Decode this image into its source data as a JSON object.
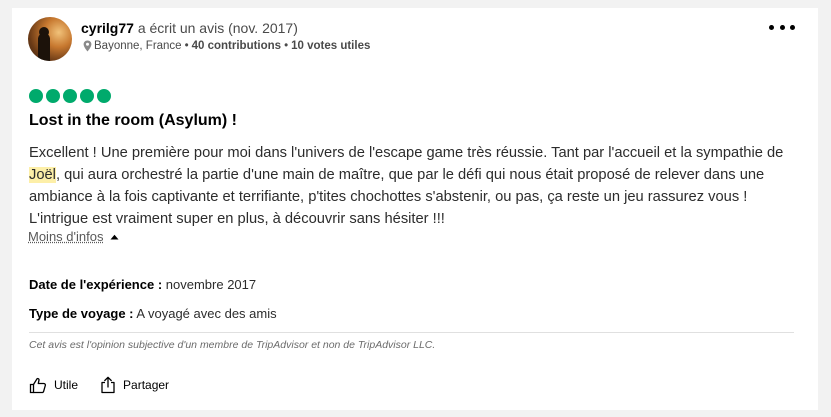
{
  "review": {
    "username": "cyrilg77",
    "header_suffix": "a écrit un avis (nov. 2017)",
    "location": "Bayonne, France",
    "separator": "•",
    "contributions": "40 contributions",
    "votes": "10 votes utiles",
    "rating": 5,
    "rating_color": "#00aa6c",
    "title": "Lost in the room (Asylum) !",
    "body_before": "Excellent ! Une première pour moi dans l'univers de l'escape game très réussie. Tant par l'accueil et la sympathie de ",
    "body_highlight": "Joël",
    "body_after": ", qui aura orchestré la partie d'une main de maître, que par le défi qui nous était proposé de relever dans une ambiance à la fois captivante et terrifiante, p'tites chochottes s'abstenir, ou pas, ça reste un jeu rassurez vous ! L'intrigue est vraiment super en plus, à découvrir sans hésiter !!!",
    "toggle_label": "Moins d'infos",
    "details": [
      {
        "label": "Date de l'expérience :",
        "value": "novembre 2017"
      },
      {
        "label": "Type de voyage :",
        "value": "A voyagé avec des amis"
      }
    ],
    "disclaimer": "Cet avis est l'opinion subjective d'un membre de TripAdvisor et non de TripAdvisor LLC.",
    "actions": {
      "helpful": "Utile",
      "share": "Partager"
    },
    "icons": {
      "more": "more-dots-icon",
      "location": "location-pin-icon",
      "toggle": "caret-up-icon",
      "helpful": "thumbs-up-icon",
      "share": "share-icon"
    }
  }
}
